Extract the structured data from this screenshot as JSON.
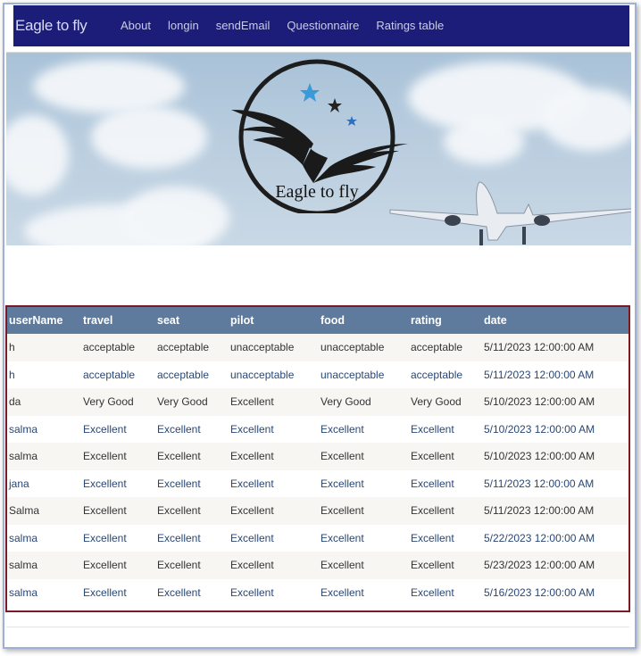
{
  "navbar": {
    "brand": "Eagle to fly",
    "links": [
      "About",
      "longin",
      "sendEmail",
      "Questionnaire",
      "Ratings table"
    ]
  },
  "hero": {
    "logo_text": "Eagle to fly",
    "star_colors": [
      "#3a9ad9",
      "#222222",
      "#2f6fc0"
    ]
  },
  "table": {
    "headers": [
      "userName",
      "travel",
      "seat",
      "pilot",
      "food",
      "rating",
      "date"
    ],
    "rows": [
      [
        "h",
        "acceptable",
        "acceptable",
        "unacceptable",
        "unacceptable",
        "acceptable",
        "5/11/2023 12:00:00 AM"
      ],
      [
        "h",
        "acceptable",
        "acceptable",
        "unacceptable",
        "unacceptable",
        "acceptable",
        "5/11/2023 12:00:00 AM"
      ],
      [
        "da",
        "Very Good",
        "Very Good",
        "Excellent",
        "Very Good",
        "Very Good",
        "5/10/2023 12:00:00 AM"
      ],
      [
        "salma",
        "Excellent",
        "Excellent",
        "Excellent",
        "Excellent",
        "Excellent",
        "5/10/2023 12:00:00 AM"
      ],
      [
        "salma",
        "Excellent",
        "Excellent",
        "Excellent",
        "Excellent",
        "Excellent",
        "5/10/2023 12:00:00 AM"
      ],
      [
        "jana",
        "Excellent",
        "Excellent",
        "Excellent",
        "Excellent",
        "Excellent",
        "5/11/2023 12:00:00 AM"
      ],
      [
        "Salma",
        "Excellent",
        "Excellent",
        "Excellent",
        "Excellent",
        "Excellent",
        "5/11/2023 12:00:00 AM"
      ],
      [
        "salma",
        "Excellent",
        "Excellent",
        "Excellent",
        "Excellent",
        "Excellent",
        "5/22/2023 12:00:00 AM"
      ],
      [
        "salma",
        "Excellent",
        "Excellent",
        "Excellent",
        "Excellent",
        "Excellent",
        "5/23/2023 12:00:00 AM"
      ],
      [
        "salma",
        "Excellent",
        "Excellent",
        "Excellent",
        "Excellent",
        "Excellent",
        "5/16/2023 12:00:00 AM"
      ]
    ]
  },
  "colors": {
    "navbar_bg": "#1c1d78",
    "table_header_bg": "#5e7a9c",
    "table_border": "#7b1a22",
    "alt_row_text": "#284775"
  }
}
